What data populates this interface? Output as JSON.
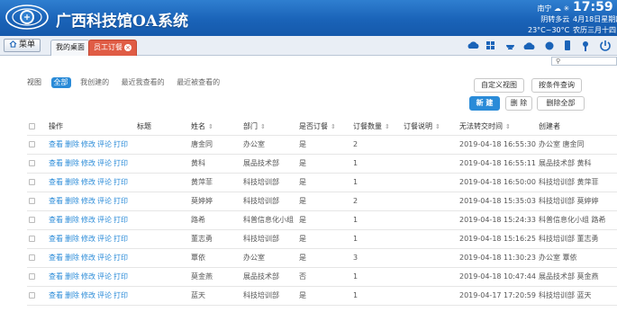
{
  "app": {
    "title": "广西科技馆OA系统"
  },
  "weather": {
    "city": "南宁",
    "desc": "阴转多云",
    "temp": "23°C~30°C"
  },
  "clock": {
    "time": "17:59",
    "date": "4月18日星期四",
    "lunar": "农历三月十四"
  },
  "menu": {
    "label": "菜单"
  },
  "tabs": [
    {
      "label": "我的桌面"
    },
    {
      "label": "员工订餐"
    }
  ],
  "toolbar_icons": [
    "cloud-icon",
    "grid-icon",
    "bowl-icon",
    "cloud-upload-icon",
    "gear-icon",
    "mobile-icon",
    "key-icon",
    "power-icon"
  ],
  "filters": {
    "label": "视图",
    "items": [
      "全部",
      "我创建的",
      "最近我查看的",
      "最近被查看的"
    ]
  },
  "buttons": {
    "custom_view": "自定义视图",
    "condition_query": "按条件查询",
    "new": "新 建",
    "delete": "删 除",
    "delete_all": "删除全部"
  },
  "table": {
    "headers": [
      "操作",
      "标题",
      "姓名",
      "部门",
      "是否订餐",
      "订餐数量",
      "订餐说明",
      "无法转交时间",
      "创建者"
    ],
    "actions": [
      "查看",
      "删除",
      "修改",
      "评论",
      "打印"
    ],
    "rows": [
      {
        "name": "唐金同",
        "dept": "办公室",
        "order": "是",
        "qty": "2",
        "time": "2019-04-18 16:55:30",
        "creator": "办公室 唐金同"
      },
      {
        "name": "黄科",
        "dept": "展品技术部",
        "order": "是",
        "qty": "1",
        "time": "2019-04-18 16:55:11",
        "creator": "展品技术部 黄科"
      },
      {
        "name": "黄萍菲",
        "dept": "科技培训部",
        "order": "是",
        "qty": "1",
        "time": "2019-04-18 16:50:00",
        "creator": "科技培训部 黄萍菲"
      },
      {
        "name": "莫婷婷",
        "dept": "科技培训部",
        "order": "是",
        "qty": "2",
        "time": "2019-04-18 15:35:03",
        "creator": "科技培训部 莫婷婷"
      },
      {
        "name": "路希",
        "dept": "科普信息化小组",
        "order": "是",
        "qty": "1",
        "time": "2019-04-18 15:24:33",
        "creator": "科普信息化小组 路希"
      },
      {
        "name": "董志勇",
        "dept": "科技培训部",
        "order": "是",
        "qty": "1",
        "time": "2019-04-18 15:16:25",
        "creator": "科技培训部 董志勇"
      },
      {
        "name": "覃依",
        "dept": "办公室",
        "order": "是",
        "qty": "3",
        "time": "2019-04-18 11:30:23",
        "creator": "办公室 覃依"
      },
      {
        "name": "莫金燕",
        "dept": "展品技术部",
        "order": "否",
        "qty": "1",
        "time": "2019-04-18 10:47:44",
        "creator": "展品技术部 莫金燕"
      },
      {
        "name": "蓝天",
        "dept": "科技培训部",
        "order": "是",
        "qty": "1",
        "time": "2019-04-17 17:20:59",
        "creator": "科技培训部 蓝天"
      }
    ]
  },
  "colors": {
    "header": "#1a63b8",
    "accent": "#2a8bd8",
    "active_tab": "#e05c45"
  }
}
